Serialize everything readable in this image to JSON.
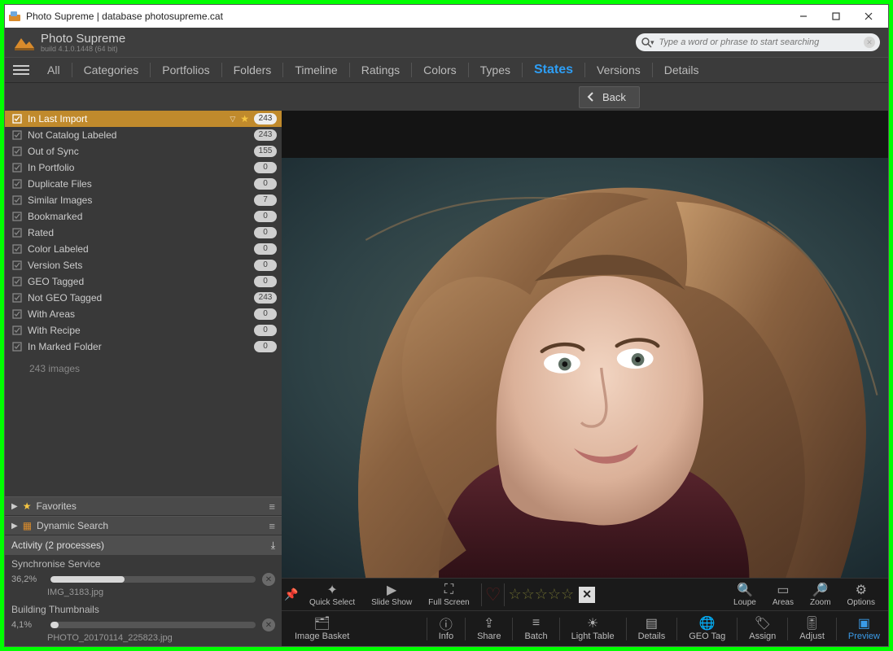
{
  "window": {
    "title": "Photo Supreme | database photosupreme.cat"
  },
  "app": {
    "name": "Photo Supreme",
    "build": "build 4.1.0.1448 (64 bit)"
  },
  "search": {
    "placeholder": "Type a word or phrase to start searching"
  },
  "nav": {
    "all": "All",
    "tabs": [
      "Categories",
      "Portfolios",
      "Folders",
      "Timeline",
      "Ratings",
      "Colors",
      "Types",
      "States",
      "Versions",
      "Details"
    ],
    "active": "States"
  },
  "back": {
    "label": "Back"
  },
  "sidebar": {
    "items": [
      {
        "label": "In Last Import",
        "count": "243",
        "selected": true,
        "star": true
      },
      {
        "label": "Not Catalog Labeled",
        "count": "243"
      },
      {
        "label": "Out of Sync",
        "count": "155"
      },
      {
        "label": "In Portfolio",
        "count": "0"
      },
      {
        "label": "Duplicate Files",
        "count": "0"
      },
      {
        "label": "Similar Images",
        "count": "7"
      },
      {
        "label": "Bookmarked",
        "count": "0"
      },
      {
        "label": "Rated",
        "count": "0"
      },
      {
        "label": "Color Labeled",
        "count": "0"
      },
      {
        "label": "Version Sets",
        "count": "0"
      },
      {
        "label": "GEO Tagged",
        "count": "0"
      },
      {
        "label": "Not GEO Tagged",
        "count": "243"
      },
      {
        "label": "With Areas",
        "count": "0"
      },
      {
        "label": "With Recipe",
        "count": "0"
      },
      {
        "label": "In Marked Folder",
        "count": "0"
      }
    ],
    "images_line": "243 images",
    "favorites": "Favorites",
    "dynamic": "Dynamic Search"
  },
  "activity": {
    "header": "Activity (2 processes)",
    "p1": {
      "name": "Synchronise Service",
      "pct": "36,2%",
      "file": "IMG_3183.jpg",
      "fill": 36.2
    },
    "p2": {
      "name": "Building Thumbnails",
      "pct": "4,1%",
      "file": "PHOTO_20170114_225823.jpg",
      "fill": 4.1
    }
  },
  "toolbar1": {
    "quick": "Quick Select",
    "slide": "Slide Show",
    "full": "Full Screen",
    "loupe": "Loupe",
    "areas": "Areas",
    "zoom": "Zoom",
    "options": "Options"
  },
  "toolbar2": {
    "basket": "Image Basket",
    "info": "Info",
    "share": "Share",
    "batch": "Batch",
    "light": "Light Table",
    "details": "Details",
    "geo": "GEO Tag",
    "assign": "Assign",
    "adjust": "Adjust",
    "preview": "Preview"
  }
}
